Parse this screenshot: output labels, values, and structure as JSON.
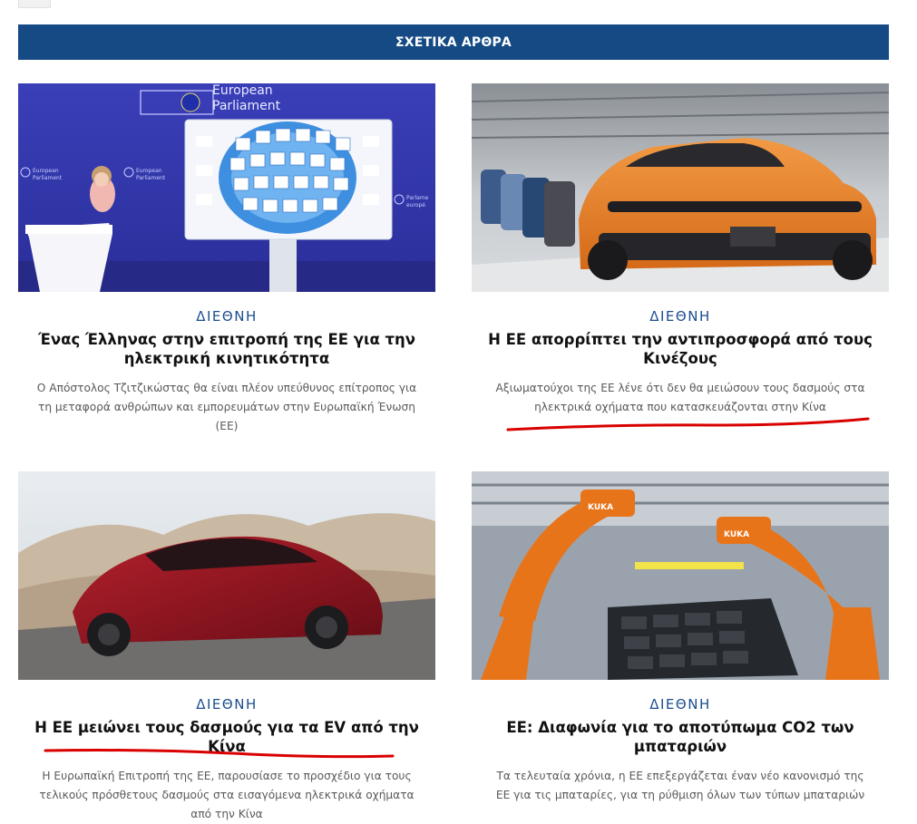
{
  "section_header": "ΣΧΕΤΙΚΑ ΑΡΘΡΑ",
  "colors": {
    "header_bg": "#154a85",
    "category": "#1a4d8f",
    "annotation": "#d90000"
  },
  "articles": [
    {
      "category": "ΔΙΕΘΝΗ",
      "title": "Ένας Έλληνας στην επιτροπή της ΕΕ για την ηλεκτρική κινητικότητα",
      "excerpt": "Ο Απόστολος Τζιτζικώστας θα είναι πλέον υπεύθυνος επίτροπος για τη μεταφορά ανθρώπων και εμπορευμάτων στην Ευρωπαϊκή Ένωση (ΕΕ)",
      "image_text": {
        "banner_line1": "European",
        "banner_line2": "Parliament",
        "side_line1": "European",
        "side_line2": "Parliament",
        "right_line1": "Parlame",
        "right_line2": "europé"
      }
    },
    {
      "category": "ΔΙΕΘΝΗ",
      "title": "Η ΕΕ απορρίπτει την αντιπροσφορά από τους Κινέζους",
      "excerpt": "Αξιωματούχοι της ΕΕ λένε ότι δεν θα μειώσουν τους δασμούς στα ηλεκτρικά οχήματα που κατασκευάζονται στην Κίνα"
    },
    {
      "category": "ΔΙΕΘΝΗ",
      "title": "Η ΕΕ μειώνει τους δασμούς για τα EV από την Κίνα",
      "excerpt": "Η Ευρωπαϊκή Επιτροπή της ΕΕ, παρουσίασε το προσχέδιο για τους τελικούς πρόσθετους δασμούς στα εισαγόμενα ηλεκτρικά οχήματα από την Κίνα"
    },
    {
      "category": "ΔΙΕΘΝΗ",
      "title": "ΕΕ: Διαφωνία για το αποτύπωμα CO2 των μπαταριών",
      "excerpt": "Τα τελευταία χρόνια, η ΕΕ επεξεργάζεται έναν νέο κανονισμό της ΕΕ για τις μπαταρίες, για τη ρύθμιση όλων των τύπων μπαταριών",
      "image_text": {
        "robot_brand": "KUKA"
      }
    }
  ]
}
